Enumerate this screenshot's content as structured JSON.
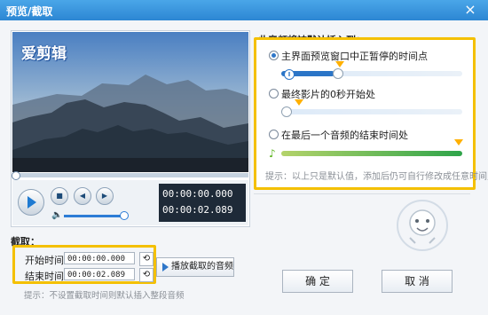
{
  "window": {
    "title": "预览/截取",
    "close_icon": "close-icon"
  },
  "preview": {
    "logo_text": "爱剪辑",
    "time_current": "00:00:00.000",
    "time_total": "00:00:02.089",
    "volume_level": 0.9
  },
  "insert_panel": {
    "title": "此音频将被默认插入到：",
    "options": [
      {
        "label": "主界面预览窗口中正暂停的时间点",
        "checked": true
      },
      {
        "label": "最终影片的0秒开始处",
        "checked": false
      },
      {
        "label": "在最后一个音频的结束时间处",
        "checked": false
      }
    ],
    "hint": "提示：以上只是默认值，添加后仍可自行修改成任意时间点"
  },
  "cut_panel": {
    "title": "截取：",
    "start_label": "开始时间：",
    "start_value": "00:00:00.000",
    "end_label": "结束时间：",
    "end_value": "00:00:02.089",
    "play_label": "播放截取的音频",
    "hint": "提示：不设置截取时间则默认插入整段音频"
  },
  "buttons": {
    "ok": "确 定",
    "cancel": "取 消"
  },
  "colors": {
    "title_bar": "#2c86d3",
    "highlight": "#f4c000",
    "accent": "#2f77c9"
  }
}
